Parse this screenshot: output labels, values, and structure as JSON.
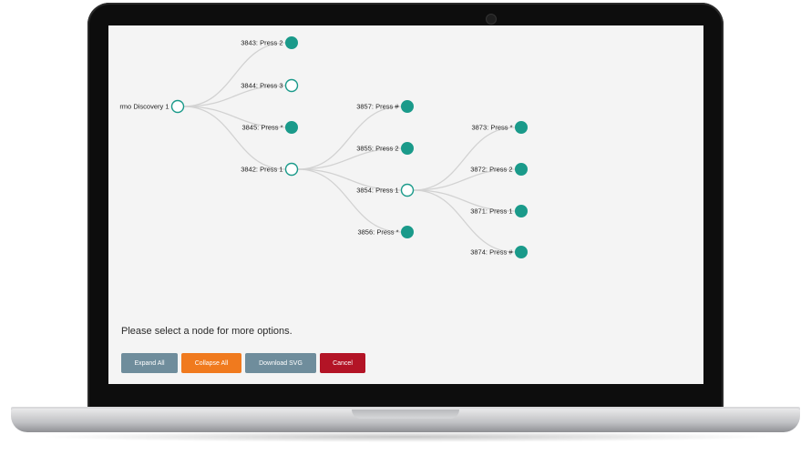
{
  "colors": {
    "node_fill": "#1a9a8a",
    "link": "#d2d2d2",
    "expand_button": "#6f8d9c",
    "collapse_button": "#f07a1e",
    "download_button": "#6f8d9c",
    "cancel_button": "#b31426"
  },
  "tree": {
    "nodes": [
      {
        "id": "root",
        "label": "rmo Discovery 1",
        "state": "expanded"
      },
      {
        "id": "n3843",
        "label": "3843: Press 2",
        "state": "collapsed"
      },
      {
        "id": "n3844",
        "label": "3844: Press 3",
        "state": "expanded"
      },
      {
        "id": "n3845",
        "label": "3845: Press *",
        "state": "collapsed"
      },
      {
        "id": "n3842",
        "label": "3842: Press 1",
        "state": "expanded"
      },
      {
        "id": "n3857",
        "label": "3857: Press #",
        "state": "collapsed"
      },
      {
        "id": "n3855",
        "label": "3855: Press 2",
        "state": "collapsed"
      },
      {
        "id": "n3854",
        "label": "3854: Press 1",
        "state": "expanded"
      },
      {
        "id": "n3856",
        "label": "3856: Press *",
        "state": "collapsed"
      },
      {
        "id": "n3873",
        "label": "3873: Press *",
        "state": "collapsed"
      },
      {
        "id": "n3872",
        "label": "3872: Press 2",
        "state": "collapsed"
      },
      {
        "id": "n3871",
        "label": "3871: Press 1",
        "state": "collapsed"
      },
      {
        "id": "n3874",
        "label": "3874: Press #",
        "state": "collapsed"
      }
    ],
    "links": [
      [
        "root",
        "n3843"
      ],
      [
        "root",
        "n3844"
      ],
      [
        "root",
        "n3845"
      ],
      [
        "root",
        "n3842"
      ],
      [
        "n3842",
        "n3857"
      ],
      [
        "n3842",
        "n3855"
      ],
      [
        "n3842",
        "n3854"
      ],
      [
        "n3842",
        "n3856"
      ],
      [
        "n3854",
        "n3873"
      ],
      [
        "n3854",
        "n3872"
      ],
      [
        "n3854",
        "n3871"
      ],
      [
        "n3854",
        "n3874"
      ]
    ]
  },
  "status_message": "Please select a node for more options.",
  "buttons": {
    "expand_all": "Expand All",
    "collapse_all": "Collapse All",
    "download_svg": "Download SVG",
    "cancel": "Cancel"
  }
}
